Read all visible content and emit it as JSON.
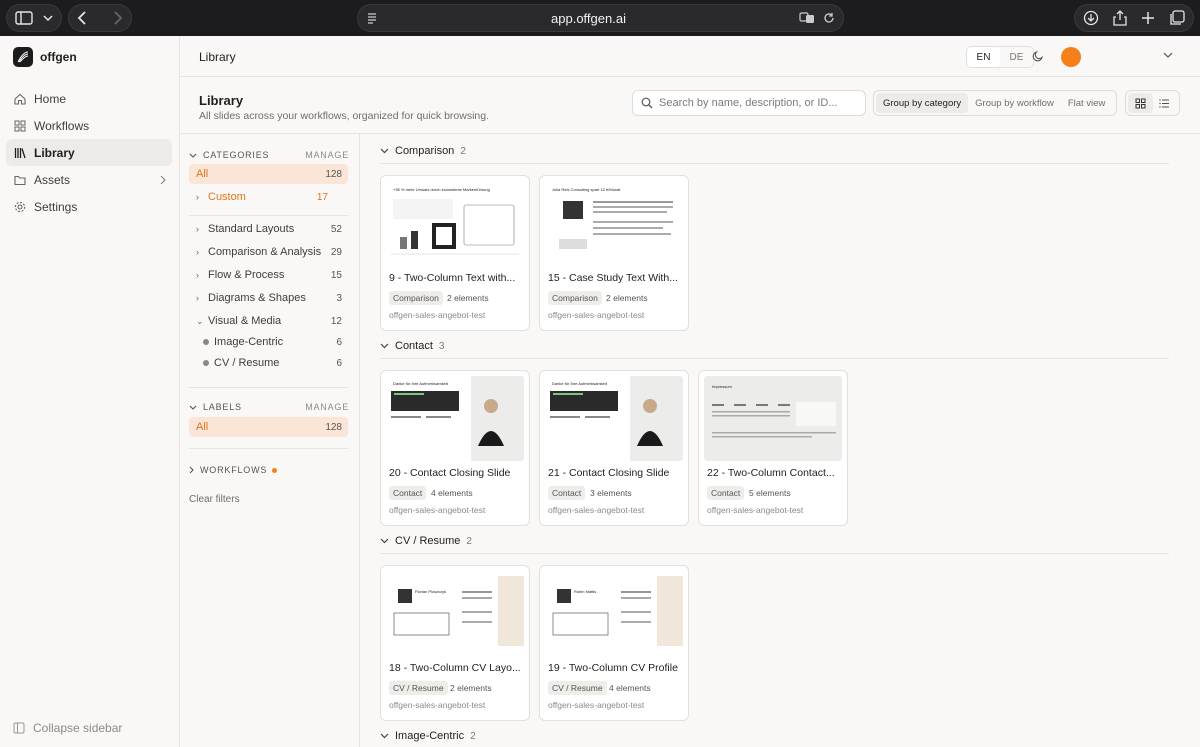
{
  "browser": {
    "url": "app.offgen.ai"
  },
  "sidebar": {
    "brand": "offgen",
    "items": [
      {
        "label": "Home",
        "icon": "home-icon"
      },
      {
        "label": "Workflows",
        "icon": "grid-icon"
      },
      {
        "label": "Library",
        "icon": "library-icon",
        "active": true
      },
      {
        "label": "Assets",
        "icon": "folder-icon"
      },
      {
        "label": "Settings",
        "icon": "gear-icon"
      }
    ],
    "collapse_label": "Collapse sidebar"
  },
  "topbar": {
    "title": "Library",
    "lang_en": "EN",
    "lang_de": "DE",
    "accent": "#f77f1a"
  },
  "header": {
    "title": "Library",
    "subtitle": "All slides across your workflows, organized for quick browsing.",
    "search_placeholder": "Search by name, description, or ID...",
    "group_by_category": "Group by category",
    "group_by_workflow": "Group by workflow",
    "flat_view": "Flat view"
  },
  "filters": {
    "categories_label": "CATEGORIES",
    "manage": "MANAGE",
    "all": {
      "label": "All",
      "count": "128"
    },
    "custom": {
      "label": "Custom",
      "count": "17"
    },
    "items": [
      {
        "label": "Standard Layouts",
        "count": "52"
      },
      {
        "label": "Comparison & Analysis",
        "count": "29"
      },
      {
        "label": "Flow & Process",
        "count": "15"
      },
      {
        "label": "Diagrams & Shapes",
        "count": "3"
      },
      {
        "label": "Visual & Media",
        "count": "12"
      }
    ],
    "sub_items": [
      {
        "label": "Image-Centric",
        "count": "6"
      },
      {
        "label": "CV / Resume",
        "count": "6"
      }
    ],
    "labels_label": "LABELS",
    "labels_all": {
      "label": "All",
      "count": "128"
    },
    "workflows_label": "WORKFLOWS",
    "clear": "Clear filters"
  },
  "groups": [
    {
      "name": "Comparison",
      "count": "2",
      "cards": [
        {
          "title": "9 - Two-Column Text with...",
          "tag": "Comparison",
          "elements": "2 elements",
          "workflow": "offgen-sales-angebot-test",
          "thumb_title": "+35 % mehr Umsatz durch konsistente Markenführung"
        },
        {
          "title": "15 - Case Study Text With...",
          "tag": "Comparison",
          "elements": "2 elements",
          "workflow": "offgen-sales-angebot-test",
          "thumb_title": "Julia Reis Consulting spart 12 h/Monat"
        }
      ]
    },
    {
      "name": "Contact",
      "count": "3",
      "cards": [
        {
          "title": "20 - Contact Closing Slide",
          "tag": "Contact",
          "elements": "4 elements",
          "workflow": "offgen-sales-angebot-test",
          "thumb_title": "Danke für Ihre Aufmerksamkeit"
        },
        {
          "title": "21 - Contact Closing Slide",
          "tag": "Contact",
          "elements": "3 elements",
          "workflow": "offgen-sales-angebot-test",
          "thumb_title": "Danke für Ihre Aufmerksamkeit"
        },
        {
          "title": "22 - Two-Column Contact...",
          "tag": "Contact",
          "elements": "5 elements",
          "workflow": "offgen-sales-angebot-test",
          "thumb_title": "Impressum"
        }
      ]
    },
    {
      "name": "CV / Resume",
      "count": "2",
      "cards": [
        {
          "title": "18 - Two-Column CV Layo...",
          "tag": "CV / Resume",
          "elements": "2 elements",
          "workflow": "offgen-sales-angebot-test",
          "thumb_title": "Florian Ploszczyk"
        },
        {
          "title": "19 - Two-Column CV Profile",
          "tag": "CV / Resume",
          "elements": "4 elements",
          "workflow": "offgen-sales-angebot-test",
          "thumb_title": "Robin Mattis"
        }
      ]
    },
    {
      "name": "Image-Centric",
      "count": "2",
      "cards": []
    }
  ]
}
